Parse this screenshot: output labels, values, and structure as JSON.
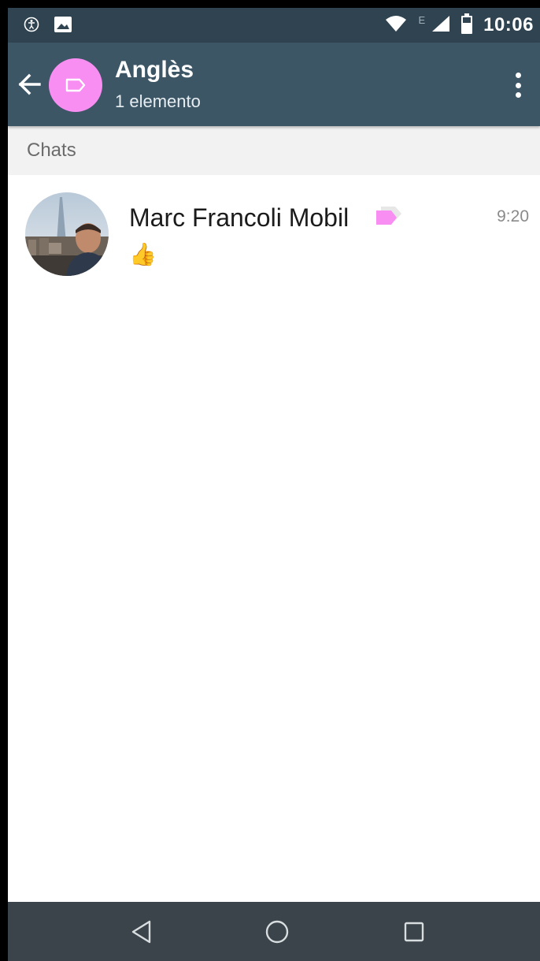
{
  "status_bar": {
    "time": "10:06",
    "network_type": "E",
    "icons": [
      "accessibility-icon",
      "image-icon",
      "wifi-icon",
      "signal-icon",
      "battery-icon"
    ]
  },
  "toolbar": {
    "title": "Anglès",
    "subtitle": "1 elemento",
    "label_color": "#f98ef2",
    "background": "#3d5666"
  },
  "section": {
    "header": "Chats"
  },
  "chats": [
    {
      "name": "Marc Francoli Mobil",
      "time": "9:20",
      "preview": "👍",
      "label_color": "#f98ef2"
    }
  ],
  "nav_bar": {
    "buttons": [
      "back-icon",
      "home-icon",
      "recents-icon"
    ]
  }
}
